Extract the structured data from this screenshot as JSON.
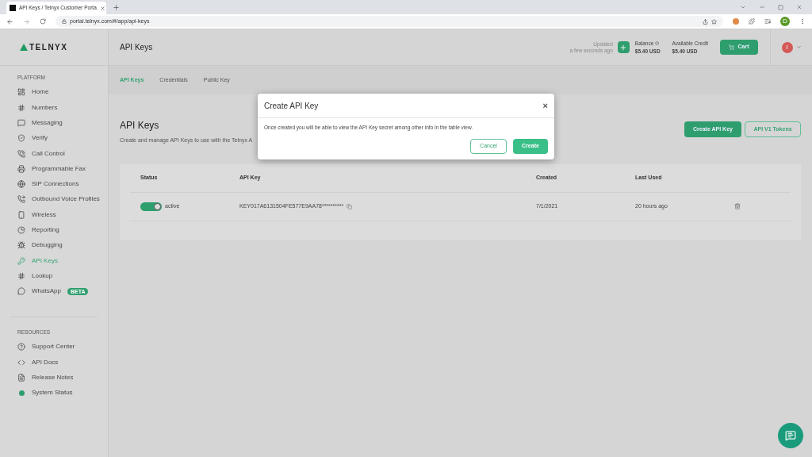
{
  "browser": {
    "tab_title": "API Keys / Telnyx Customer Porta",
    "url": "portal.telnyx.com/#/app/api-keys",
    "profile_initial": "D"
  },
  "sidebar": {
    "logo": "TELNYX",
    "sections": [
      {
        "title": "PLATFORM",
        "items": [
          {
            "label": "Home",
            "selected": false
          },
          {
            "label": "Numbers",
            "selected": false
          },
          {
            "label": "Messaging",
            "selected": false
          },
          {
            "label": "Verify",
            "selected": false
          },
          {
            "label": "Call Control",
            "selected": false
          },
          {
            "label": "Programmable Fax",
            "selected": false
          },
          {
            "label": "SIP Connections",
            "selected": false
          },
          {
            "label": "Outbound Voice Profiles",
            "selected": false
          },
          {
            "label": "Wireless",
            "selected": false
          },
          {
            "label": "Reporting",
            "selected": false
          },
          {
            "label": "Debugging",
            "selected": false
          },
          {
            "label": "API Keys",
            "selected": true
          },
          {
            "label": "Lookup",
            "selected": false
          },
          {
            "label": "WhatsApp",
            "selected": false,
            "badge": "BETA"
          }
        ]
      },
      {
        "title": "RESOURCES",
        "items": [
          {
            "label": "Support Center",
            "selected": false
          },
          {
            "label": "API Docs",
            "selected": false
          },
          {
            "label": "Release Notes",
            "selected": false
          },
          {
            "label": "System Status",
            "selected": false
          }
        ]
      }
    ]
  },
  "header": {
    "title": "API Keys",
    "updated": "Updated",
    "updated_time": "a few seconds ago",
    "balance_label": "Balance",
    "balance": "$5.40 USD",
    "credit_label": "Available Credit",
    "credit": "$5.40 USD",
    "cart": "Cart",
    "avatar": "I"
  },
  "tabs": [
    {
      "label": "API Keys",
      "selected": true
    },
    {
      "label": "Credentials",
      "selected": false
    },
    {
      "label": "Public Key",
      "selected": false
    }
  ],
  "page": {
    "title": "API Keys",
    "subtitle": "Create and manage API Keys to use with the Telnyx A",
    "buttons": [
      "Create API Key",
      "API V1 Tokens"
    ]
  },
  "table": {
    "columns": [
      "Status",
      "API Key",
      "Created",
      "Last Used"
    ],
    "rows": [
      {
        "on": true,
        "status": "active",
        "key": "KEY017A6131504FE577E9AA78**********",
        "created": "7/1/2021",
        "last_used": "20 hours ago"
      }
    ]
  },
  "dialog": {
    "title": "Create API Key",
    "close": "×",
    "message": "Once created you will be able to view the API Key secret among other info in the table view.",
    "cancel": "Cancel",
    "confirm": "Create"
  }
}
